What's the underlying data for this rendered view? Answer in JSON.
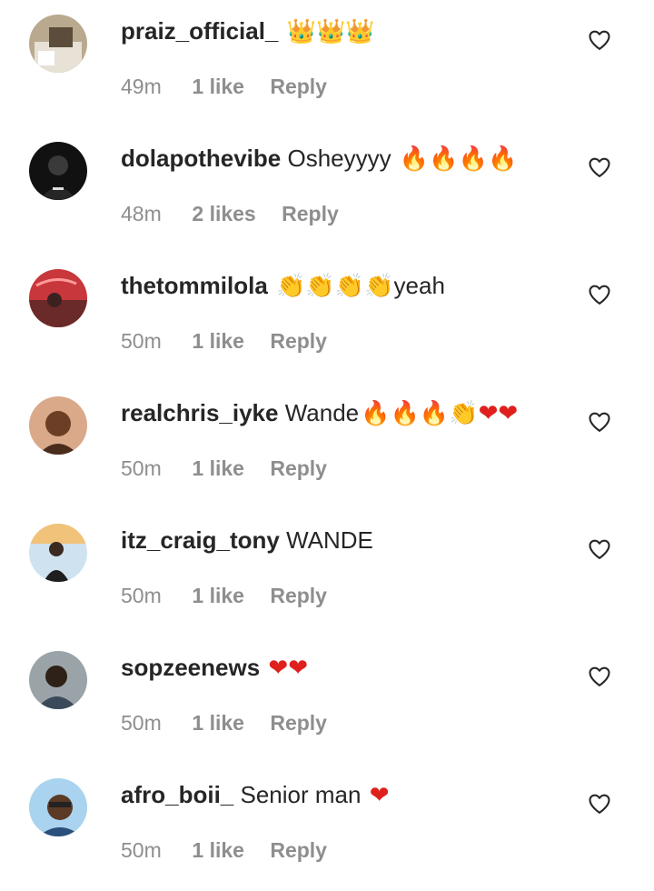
{
  "comments": [
    {
      "username": "praiz_official_",
      "text": "",
      "emoji": "👑👑👑",
      "time": "49m",
      "likes": "1 like",
      "reply": "Reply",
      "emoji_color": "#e8b400"
    },
    {
      "username": "dolapothevibe",
      "text": "Osheyyyy",
      "emoji": "🔥🔥🔥🔥",
      "time": "48m",
      "likes": "2 likes",
      "reply": "Reply",
      "emoji_color": "#f36a1c"
    },
    {
      "username": "thetommilola",
      "text": "yeah",
      "emoji": "👏👏👏👏",
      "time": "50m",
      "likes": "1 like",
      "reply": "Reply",
      "emoji_color": "#f5c518"
    },
    {
      "username": "realchris_iyke",
      "text": "Wande",
      "emoji": "🔥🔥🔥👏❤❤",
      "time": "50m",
      "likes": "1 like",
      "reply": "Reply",
      "emoji_color": "#e0201d"
    },
    {
      "username": "itz_craig_tony",
      "text": "WANDE",
      "emoji": "",
      "time": "50m",
      "likes": "1 like",
      "reply": "Reply",
      "emoji_color": "#262626"
    },
    {
      "username": "sopzeenews",
      "text": "",
      "emoji": "❤❤",
      "time": "50m",
      "likes": "1 like",
      "reply": "Reply",
      "emoji_color": "#e0201d"
    },
    {
      "username": "afro_boii_",
      "text": "Senior man",
      "emoji": "❤",
      "time": "50m",
      "likes": "1 like",
      "reply": "Reply",
      "emoji_color": "#e0201d"
    }
  ],
  "icons": {
    "like": "heart-outline-icon"
  },
  "colors": {
    "text_primary": "#262626",
    "text_secondary": "#8e8e8e",
    "background": "#ffffff"
  }
}
